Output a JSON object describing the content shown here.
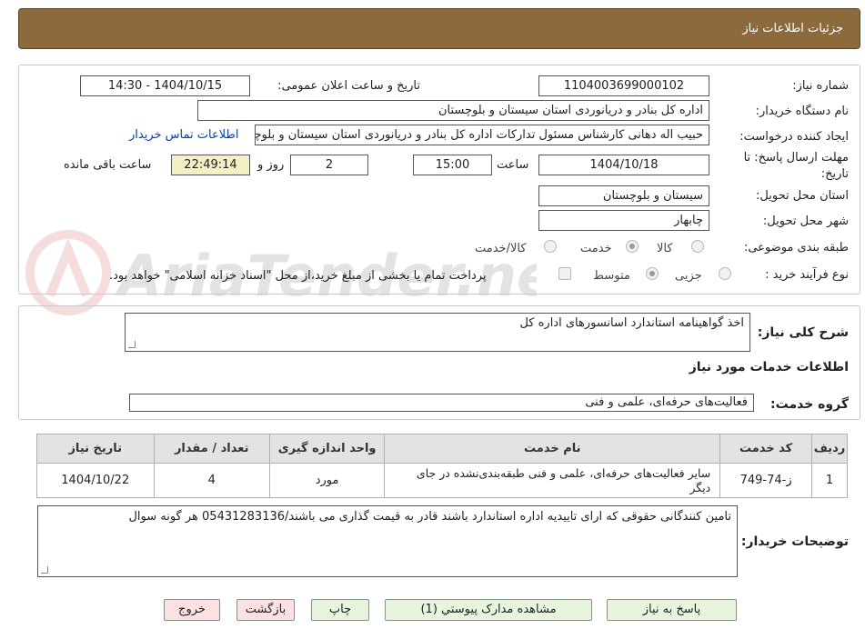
{
  "header": {
    "title": "جزئیات اطلاعات نیاز"
  },
  "form": {
    "need_number_label": "شماره نیاز:",
    "need_number": "1104003699000102",
    "announce_label": "تاریخ و ساعت اعلان عمومی:",
    "announce_value": "1404/10/15 - 14:30",
    "buyer_org_label": "نام دستگاه خریدار:",
    "buyer_org": "اداره کل بنادر و دریانوردی استان سیستان و بلوچستان",
    "requester_label": "ایجاد کننده درخواست:",
    "requester": "حبیب اله دهانی کارشناس مسئول تدارکات اداره کل بنادر و دریانوردی استان سیستان و بلوچستان",
    "contact_link": "اطلاعات تماس خریدار",
    "deadline_label_1": "مهلت ارسال پاسخ: تا",
    "deadline_label_2": "تاریخ:",
    "deadline_date": "1404/10/18",
    "time_label": "ساعت",
    "deadline_time": "15:00",
    "days": "2",
    "days_label": "روز و",
    "remaining": "22:49:14",
    "remaining_label": "ساعت باقی مانده",
    "province_label": "استان محل تحویل:",
    "province": "سیستان و بلوچستان",
    "city_label": "شهر محل تحویل:",
    "city": "چابهار",
    "category_label": "طبقه بندی موضوعی:",
    "category_options": [
      "کالا",
      "خدمت",
      "کالا/خدمت"
    ],
    "category_selected": "خدمت",
    "process_label": "نوع فرآیند خرید :",
    "process_options": [
      "جزیی",
      "متوسط"
    ],
    "process_selected": "متوسط",
    "treasury_text": "پرداخت تمام یا بخشی از مبلغ خرید،از محل \"اسناد خزانه اسلامی\" خواهد بود."
  },
  "summary": {
    "label": "شرح کلی نیاز:",
    "value": "اخذ گواهینامه استاندارد اسانسورهای اداره کل"
  },
  "services_section": {
    "title": "اطلاعات خدمات مورد نیاز",
    "group_label": "گروه خدمت:",
    "group_value": "فعالیت‌های حرفه‌ای، علمی و فنی"
  },
  "table": {
    "headers": [
      "ردیف",
      "کد خدمت",
      "نام خدمت",
      "واحد اندازه گیری",
      "تعداد / مقدار",
      "تاریخ نیاز"
    ],
    "rows": [
      [
        "1",
        "ز-74-749",
        "سایر فعالیت‌های حرفه‌ای، علمی و فنی طبقه‌بندی‌نشده در جای دیگر",
        "مورد",
        "4",
        "1404/10/22"
      ]
    ]
  },
  "buyer_notes": {
    "label": "توضیحات خریدار:",
    "value": "تامین کنندگانی حقوقی که ارای تاییدیه اداره  استاندارد باشند قادر به قیمت گذاری می باشند/05431283136 هر گونه سوال"
  },
  "buttons": {
    "reply": "پاسخ به نیاز",
    "attachments": "مشاهده مدارک پیوستي (1)",
    "print": "چاپ",
    "back": "بازگشت",
    "exit": "خروج"
  },
  "watermark": {
    "text": "AriaTender.neT"
  },
  "colors": {
    "header_bg": "#8c6a3c",
    "link": "#0a3ea8",
    "remaining_bg": "#f3f0c4",
    "button_bg": "#e8f5de",
    "button_pink": "#fbe1e1"
  }
}
